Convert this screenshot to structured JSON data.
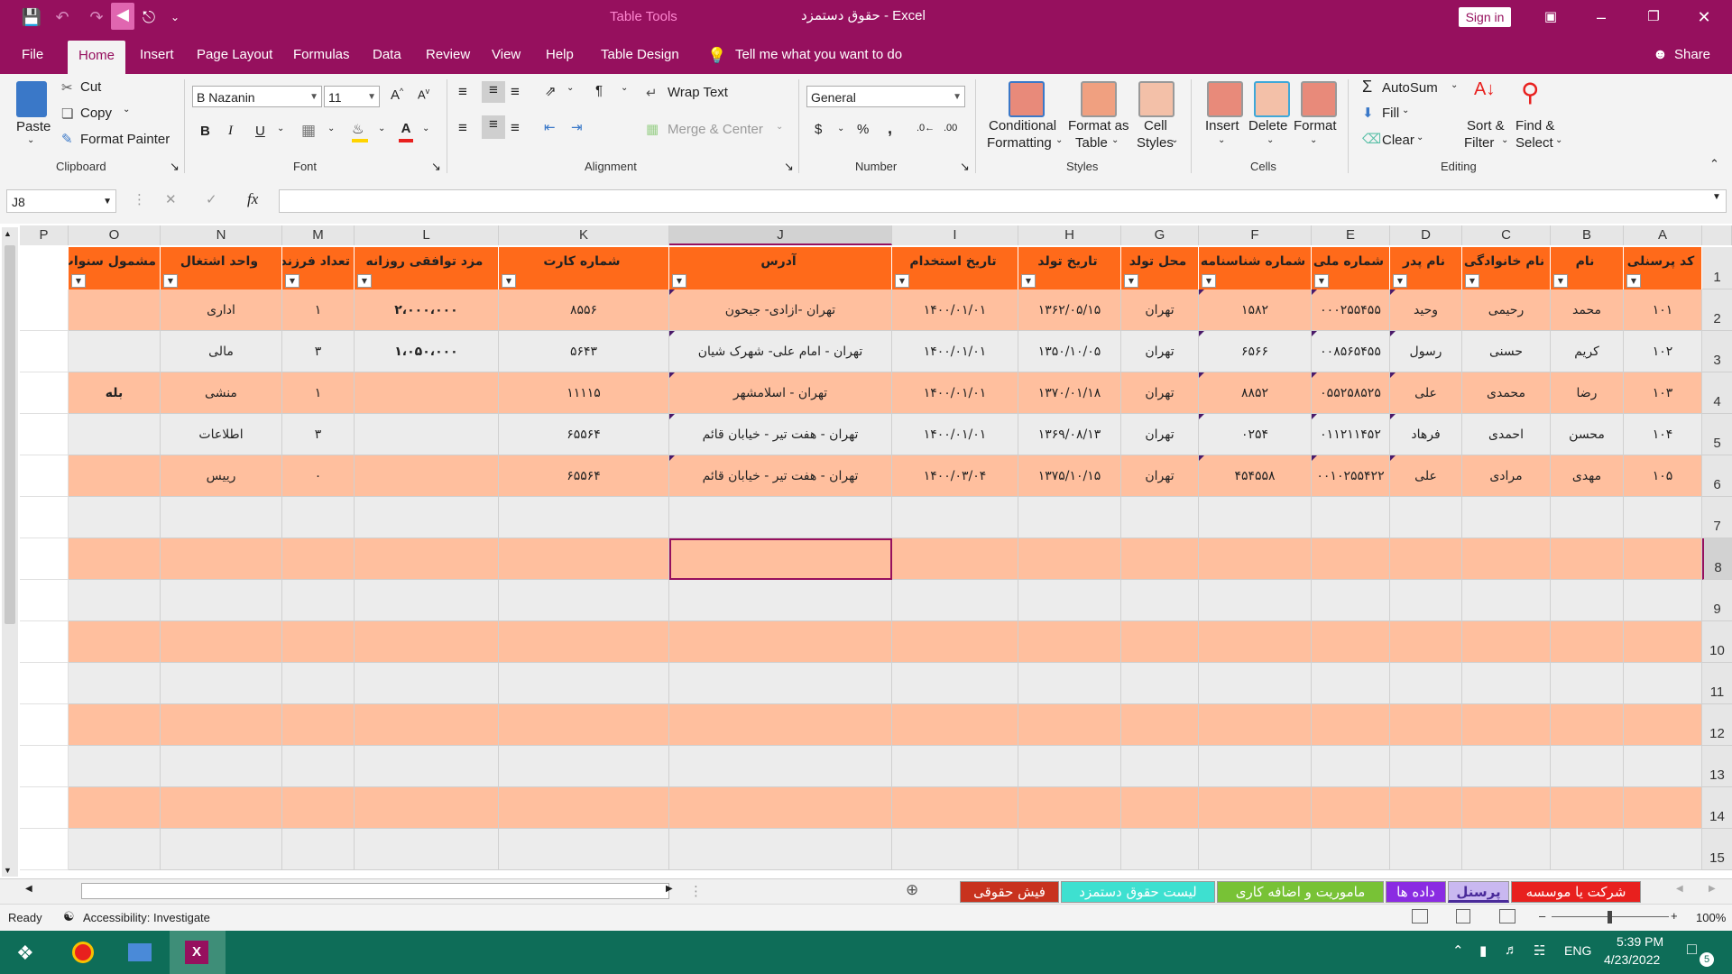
{
  "window": {
    "title": "حقوق دستمزد  -  Excel",
    "context_tab_group": "Table Tools",
    "sign_in": "Sign in",
    "share": "Share"
  },
  "tabs": [
    "File",
    "Home",
    "Insert",
    "Page Layout",
    "Formulas",
    "Data",
    "Review",
    "View",
    "Help",
    "Table Design"
  ],
  "tell_me": "Tell me what you want to do",
  "ribbon": {
    "clipboard": {
      "paste": "Paste",
      "cut": "Cut",
      "copy": "Copy",
      "format_painter": "Format Painter",
      "group": "Clipboard"
    },
    "font": {
      "name": "B Nazanin",
      "size": "11",
      "group": "Font",
      "bold": "B",
      "italic": "I",
      "underline": "U"
    },
    "alignment": {
      "wrap_text": "Wrap Text",
      "merge_center": "Merge & Center",
      "group": "Alignment"
    },
    "number": {
      "format": "General",
      "group": "Number",
      "currency": "$",
      "percent": "%",
      "comma": ","
    },
    "styles": {
      "conditional": "Conditional",
      "conditional2": "Formatting",
      "format_as": "Format as",
      "format_as2": "Table",
      "cell": "Cell",
      "cell2": "Styles",
      "group": "Styles"
    },
    "cells": {
      "insert": "Insert",
      "delete": "Delete",
      "format": "Format",
      "group": "Cells"
    },
    "editing": {
      "autosum": "AutoSum",
      "fill": "Fill",
      "clear": "Clear",
      "sort": "Sort &",
      "sort2": "Filter",
      "find": "Find &",
      "find2": "Select",
      "group": "Editing"
    }
  },
  "formula_bar": {
    "name_box": "J8",
    "fx": "fx",
    "value": ""
  },
  "columns": [
    "A",
    "B",
    "C",
    "D",
    "E",
    "F",
    "G",
    "H",
    "I",
    "J",
    "K",
    "L",
    "M",
    "N",
    "O",
    "P"
  ],
  "row_numbers": [
    "1",
    "2",
    "3",
    "4",
    "5",
    "6",
    "7",
    "8",
    "9",
    "10",
    "11",
    "12",
    "13",
    "14",
    "15"
  ],
  "headers": [
    "کد پرسنلی",
    "نام",
    "نام خانوادگی",
    "نام پدر",
    "شماره ملی",
    "شماره شناسنامه",
    "محل تولد",
    "تاریخ تولد",
    "تاریخ استخدام",
    "آدرس",
    "شماره کارت",
    "مزد توافقی روزانه",
    "تعداد فرزند",
    "واحد اشتغال",
    "مشمول سنوات"
  ],
  "rows": [
    [
      "۱۰۱",
      "محمد",
      "رحیمی",
      "وحید",
      "۰۰۰۲۵۵۴۵۵",
      "۱۵۸۲",
      "تهران",
      "۱۳۶۲/۰۵/۱۵",
      "۱۴۰۰/۰۱/۰۱",
      "تهران -ازادی- جیحون",
      "۸۵۵۶",
      "۲،۰۰۰،۰۰۰",
      "۱",
      "اداری",
      ""
    ],
    [
      "۱۰۲",
      "کریم",
      "حسنی",
      "رسول",
      "۰۰۸۵۶۵۴۵۵",
      "۶۵۶۶",
      "تهران",
      "۱۳۵۰/۱۰/۰۵",
      "۱۴۰۰/۰۱/۰۱",
      "تهران - امام علی- شهرک شیان",
      "۵۶۴۳",
      "۱،۰۵۰،۰۰۰",
      "۳",
      "مالی",
      ""
    ],
    [
      "۱۰۳",
      "رضا",
      "محمدی",
      "علی",
      "۰۵۵۲۵۸۵۲۵",
      "۸۸۵۲",
      "تهران",
      "۱۳۷۰/۰۱/۱۸",
      "۱۴۰۰/۰۱/۰۱",
      "تهران - اسلامشهر",
      "۱۱۱۱۵",
      "",
      "۱",
      "منشی",
      "بله"
    ],
    [
      "۱۰۴",
      "محسن",
      "احمدی",
      "فرهاد",
      "۰۱۱۲۱۱۴۵۲",
      "۰۲۵۴",
      "تهران",
      "۱۳۶۹/۰۸/۱۳",
      "۱۴۰۰/۰۱/۰۱",
      "تهران - هفت تیر - خیابان قائم",
      "۶۵۵۶۴",
      "",
      "۳",
      "اطلاعات",
      ""
    ],
    [
      "۱۰۵",
      "مهدی",
      "مرادی",
      "علی",
      "۰۰۱۰۲۵۵۴۲۲",
      "۴۵۴۵۵۸",
      "تهران",
      "۱۳۷۵/۱۰/۱۵",
      "۱۴۰۰/۰۳/۰۴",
      "تهران - هفت تیر - خیابان قائم",
      "۶۵۵۶۴",
      "",
      "۰",
      "رییس",
      ""
    ]
  ],
  "sheet_tabs": [
    {
      "label": "شرکت یا موسسه",
      "bg": "#e8201e",
      "fg": "#ffffff"
    },
    {
      "label": "پرسنل",
      "bg": "#c9b8f0",
      "fg": "#4a2b9a"
    },
    {
      "label": "داده ها",
      "bg": "#8a2be2",
      "fg": "#ffffff"
    },
    {
      "label": "ماموریت و اضافه کاری",
      "bg": "#78c236",
      "fg": "#ffffff"
    },
    {
      "label": "لیست حقوق دستمزد",
      "bg": "#3ee0d0",
      "fg": "#ffffff"
    },
    {
      "label": "فیش حقوقی",
      "bg": "#c8321e",
      "fg": "#ffffff"
    }
  ],
  "status": {
    "ready": "Ready",
    "accessibility": "Accessibility: Investigate",
    "zoom": "100%"
  },
  "taskbar": {
    "time": "5:39 PM",
    "date": "4/23/2022",
    "lang": "ENG",
    "notifications": "5"
  },
  "colors": {
    "accent": "#96105e",
    "header": "#ff6a1a",
    "band": "#ffbf9e"
  }
}
